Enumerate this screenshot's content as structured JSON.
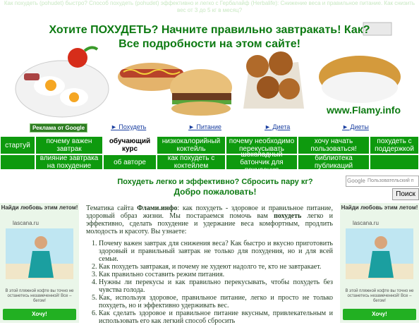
{
  "top_text": "Как похудеть (pohudet) быстро? Способ похудеть (pohudet) эффективно и легко с Гербалайф (Herbalife): Снижение веса и правильное питание. Как снизить вес от 3 до 5 кг в месяц?",
  "banner": {
    "headline1": "Хотите ПОХУДЕТЬ? Начните правильно завтракать! Как?",
    "headline2": "Все подробности на этом сайте!",
    "site": "www.Flamy.info"
  },
  "adbar": {
    "label": "Реклама от Google",
    "links": [
      "► Похудеть",
      "► Питание",
      "► Диета",
      "► Диеты"
    ]
  },
  "nav": {
    "row1": [
      "стартуй",
      "почему важен завтрак",
      "обучающий курс",
      "низкокалорийный коктейль",
      "почему необходимо перекусывать",
      "хочу начать пользоваться!",
      "похудеть с поддержкой"
    ],
    "row2": [
      "влияние завтрака на похудение",
      "об авторе",
      "как похудеть с коктейлем",
      "шоколадный батончик для похудения",
      "библиотека публикаций"
    ]
  },
  "main": {
    "title1": "Похудеть легко и эффективно? Сбросить пару кг?",
    "title2": "Добро пожаловать!",
    "intro_a": "Тематика сайта ",
    "intro_site": "Флами.инфо",
    "intro_b": ": как похудеть - здоровое и правильное питание, здоровый образ жизни. Мы постараемся помочь вам ",
    "intro_kw": "похудеть",
    "intro_c": " легко и эффективно, сделать похудение и удержание веса комфортным, продлить молодость и красоту. Вы узнаете:",
    "items": [
      "Почему важен завтрак для снижения веса? Как быстро и вкусно приготовить здоровый и правильный завтрак не только для похудения, но и для всей семьи.",
      "Как похудеть завтракая, и почему не худеют надолго те, кто не завтракает.",
      "Как правильно составить режим питания.",
      "Нужны ли перекусы и как правильно перекусывать, чтобы похудеть без чувства голода.",
      "Как, используя здоровое, правильное питание, легко и просто не только похудеть, но и эффективно удерживать вес.",
      "Как сделать здоровое и правильное питание вкусным, привлекательным и использовать его как легкий способ сбросить"
    ]
  },
  "search": {
    "logo": "Google",
    "placeholder": "Пользовательский п",
    "button": "Поиск"
  },
  "ad": {
    "title": "Найди любовь этим летом!",
    "source": "lascana.ru",
    "desc": "В этой пляжной кофте вы точно не останетесь незамеченной! Все – бегом!",
    "button": "Хочу!"
  }
}
